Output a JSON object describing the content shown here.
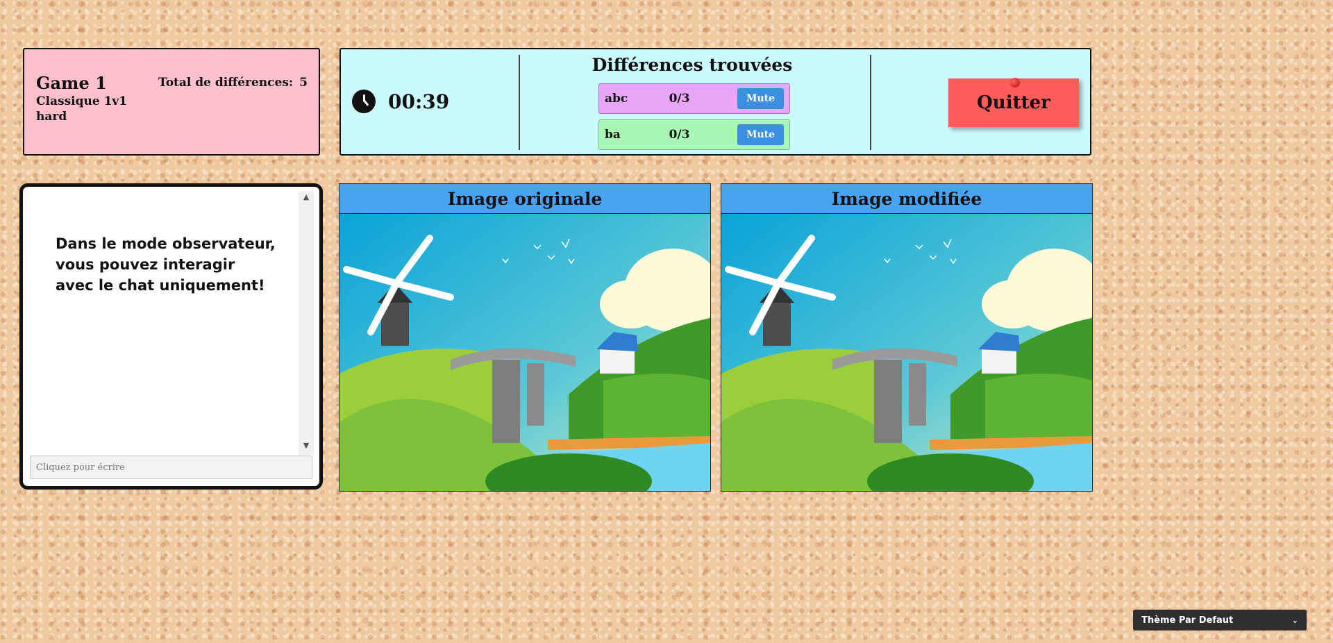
{
  "game_info": {
    "name": "Game 1",
    "mode": "Classique 1v1",
    "difficulty": "hard",
    "total_label": "Total de différences:",
    "total_value": "5"
  },
  "timer": {
    "icon": "clock-icon",
    "value": "00:39"
  },
  "differences": {
    "title": "Différences trouvées",
    "players": [
      {
        "name": "abc",
        "score": "0/3",
        "mute_label": "Mute",
        "color": "#e7a6f7"
      },
      {
        "name": "ba",
        "score": "0/3",
        "mute_label": "Mute",
        "color": "#a9f7b4"
      }
    ]
  },
  "quit_label": "Quitter",
  "chat": {
    "message": "Dans le mode observateur, vous pouvez interagir avec le chat uniquement!",
    "placeholder": "Cliquez pour écrire"
  },
  "images": {
    "original_title": "Image originale",
    "modified_title": "Image modifiée"
  },
  "theme": {
    "selected": "Thème Par Defaut"
  },
  "colors": {
    "info_panel": "#ffc0cb",
    "game_bar": "#ccfbfd",
    "image_header": "#4aa3f2",
    "quit_button": "#ff5c5c",
    "mute_button": "#3a8fe0"
  }
}
